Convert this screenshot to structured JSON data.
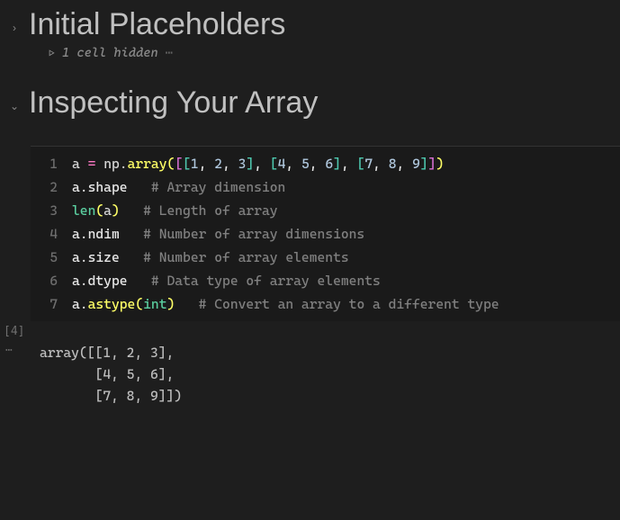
{
  "sections": {
    "first": {
      "chevron": "›",
      "heading": "Initial Placeholders",
      "hidden_play": "▷",
      "hidden_text": "1 cell hidden",
      "hidden_dots": "⋯"
    },
    "second": {
      "chevron": "⌄",
      "heading": "Inspecting Your Array"
    }
  },
  "code": {
    "line1": {
      "no": "1",
      "a": "a",
      "sp1": " ",
      "eq": "=",
      "sp2": " ",
      "np": "np",
      "dot": ".",
      "fn": "array",
      "p1": "(",
      "b1": "[",
      "b2": "[",
      "n1": "1",
      "c1": ", ",
      "n2": "2",
      "c2": ", ",
      "n3": "3",
      "b3": "]",
      "c3": ", ",
      "b4": "[",
      "n4": "4",
      "c4": ", ",
      "n5": "5",
      "c5": ", ",
      "n6": "6",
      "b5": "]",
      "c6": ", ",
      "b6": "[",
      "n7": "7",
      "c7": ", ",
      "n8": "8",
      "c8": ", ",
      "n9": "9",
      "b7": "]",
      "b8": "]",
      "p2": ")"
    },
    "line2": {
      "no": "2",
      "a": "a",
      "dot": ".",
      "attr": "shape",
      "sp": "   ",
      "cm": "# Array dimension"
    },
    "line3": {
      "no": "3",
      "fn": "len",
      "p1": "(",
      "a": "a",
      "p2": ")",
      "sp": "   ",
      "cm": "# Length of array"
    },
    "line4": {
      "no": "4",
      "a": "a",
      "dot": ".",
      "attr": "ndim",
      "sp": "   ",
      "cm": "# Number of array dimensions"
    },
    "line5": {
      "no": "5",
      "a": "a",
      "dot": ".",
      "attr": "size",
      "sp": "   ",
      "cm": "# Number of array elements"
    },
    "line6": {
      "no": "6",
      "a": "a",
      "dot": ".",
      "attr": "dtype",
      "sp": "   ",
      "cm": "# Data type of array elements"
    },
    "line7": {
      "no": "7",
      "a": "a",
      "dot": ".",
      "fn": "astype",
      "p1": "(",
      "t": "int",
      "p2": ")",
      "sp": "   ",
      "cm": "# Convert an array to a different type"
    }
  },
  "exec_count": "[4]",
  "output_dots": "⋯",
  "output": "array([[1, 2, 3],\n       [4, 5, 6],\n       [7, 8, 9]])"
}
